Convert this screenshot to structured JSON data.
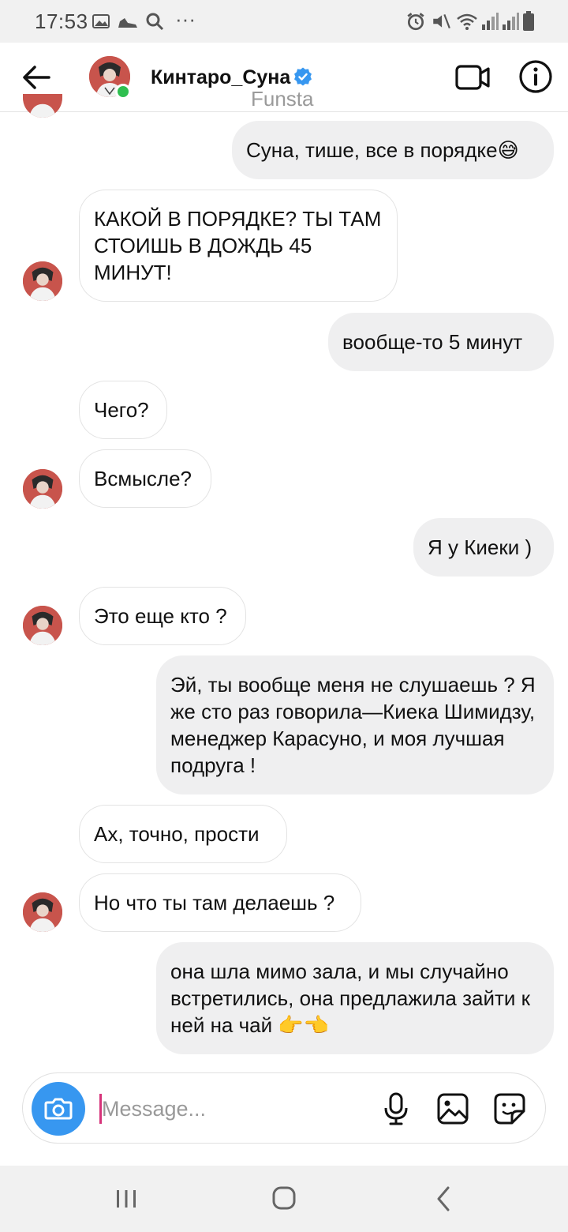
{
  "status_bar": {
    "time": "17:53"
  },
  "header": {
    "contact_name": "Кинтаро_Суна",
    "subtitle": "Funsta",
    "online": true,
    "verified": true
  },
  "messages": [
    {
      "side": "out",
      "text": "Суна, тише, все в порядке😅"
    },
    {
      "side": "in",
      "text": "КАКОЙ В ПОРЯДКЕ? ТЫ ТАМ СТОИШЬ В ДОЖДЬ 45 МИНУТ!"
    },
    {
      "side": "out",
      "text": "вообще-то 5 минут"
    },
    {
      "side": "in",
      "text": "Чего?"
    },
    {
      "side": "in",
      "text": "Всмысле?"
    },
    {
      "side": "out",
      "text": "Я у Киеки )"
    },
    {
      "side": "in",
      "text": "Это еще кто ?"
    },
    {
      "side": "out",
      "text": "Эй, ты вообще меня не слушаешь ? Я же сто раз говорила—Киека Шимидзу, менеджер Карасуно, и моя лучшая подруга !"
    },
    {
      "side": "in",
      "text": "Ах, точно, прости"
    },
    {
      "side": "in",
      "text": "Но что ты там делаешь ?"
    },
    {
      "side": "out",
      "text": "она шла мимо зала, и мы случайно встретились, она предлажила зайти к ней на чай 👉👈"
    }
  ],
  "composer": {
    "placeholder": "Message...",
    "value": ""
  },
  "colors": {
    "accent": "#3797f0",
    "online": "#2fbf50",
    "outgoing_bubble": "#efeff0",
    "caret": "#d6337a"
  },
  "icons": {
    "header": [
      "back-arrow-icon",
      "verified-badge-icon",
      "video-call-icon",
      "info-icon"
    ],
    "composer": [
      "camera-icon",
      "microphone-icon",
      "gallery-icon",
      "sticker-icon"
    ],
    "navigation": [
      "recent-apps-icon",
      "home-icon",
      "back-icon"
    ]
  }
}
